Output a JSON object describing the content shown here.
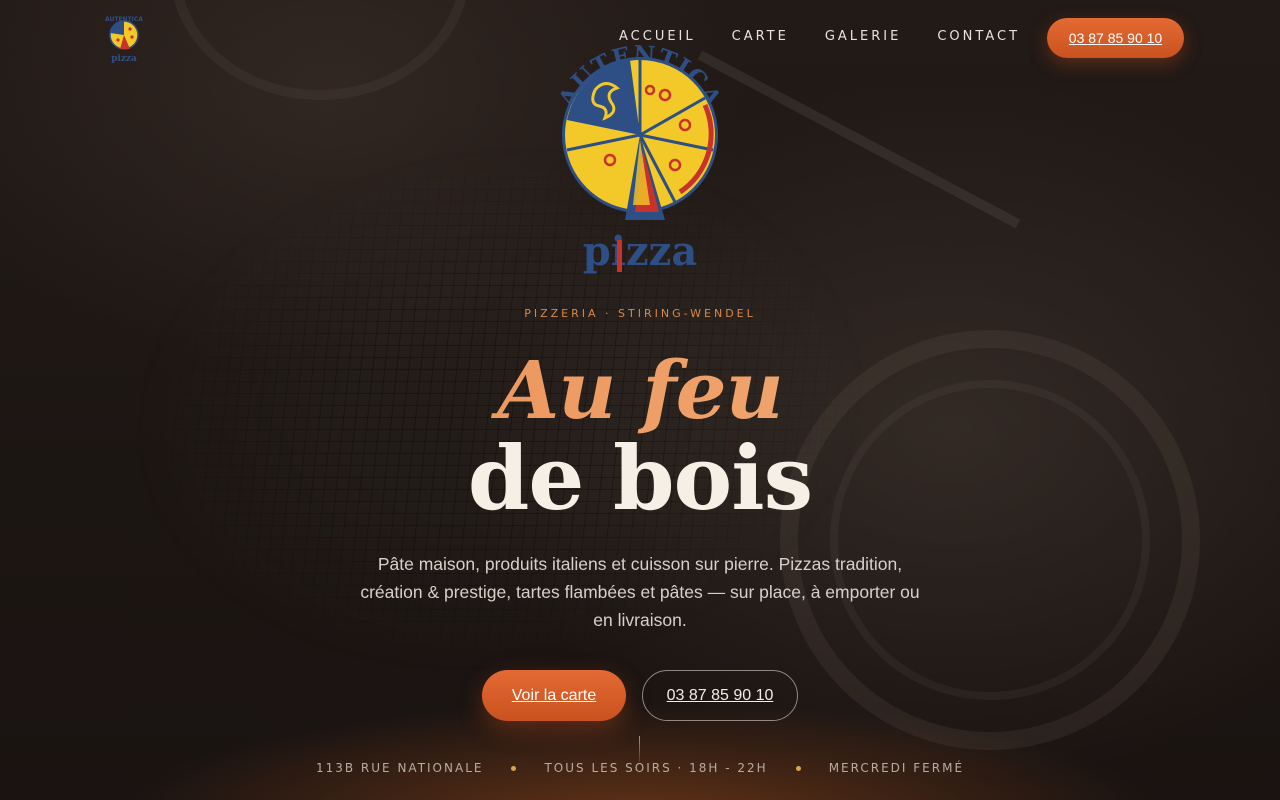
{
  "brand": {
    "logo_text_top": "AUTENTICA",
    "logo_text_bottom": "pizza"
  },
  "nav": {
    "items": [
      {
        "label": "ACCUEIL"
      },
      {
        "label": "CARTE"
      },
      {
        "label": "GALERIE"
      },
      {
        "label": "CONTACT"
      }
    ],
    "phone_button": "03 87 85 90 10"
  },
  "hero": {
    "kicker": "PIZZERIA · STIRING-WENDEL",
    "title_line1": "Au feu",
    "title_line2": "de bois",
    "description": "Pâte maison, produits italiens et cuisson sur pierre. Pizzas tradition, création & prestige, tartes flambées et pâtes — sur place, à emporter ou en livraison.",
    "primary_button": "Voir la carte",
    "secondary_button": "03 87 85 90 10"
  },
  "info_bar": {
    "items": [
      "113B RUE NATIONALE",
      "TOUS LES SOIRS · 18H - 22H",
      "MERCREDI FERMÉ"
    ]
  },
  "colors": {
    "accent": "#e46a33",
    "gold": "#d9894a",
    "background": "#1a1412",
    "logo_yellow": "#f2c928",
    "logo_blue": "#2e4f86",
    "logo_red": "#c8322a"
  }
}
